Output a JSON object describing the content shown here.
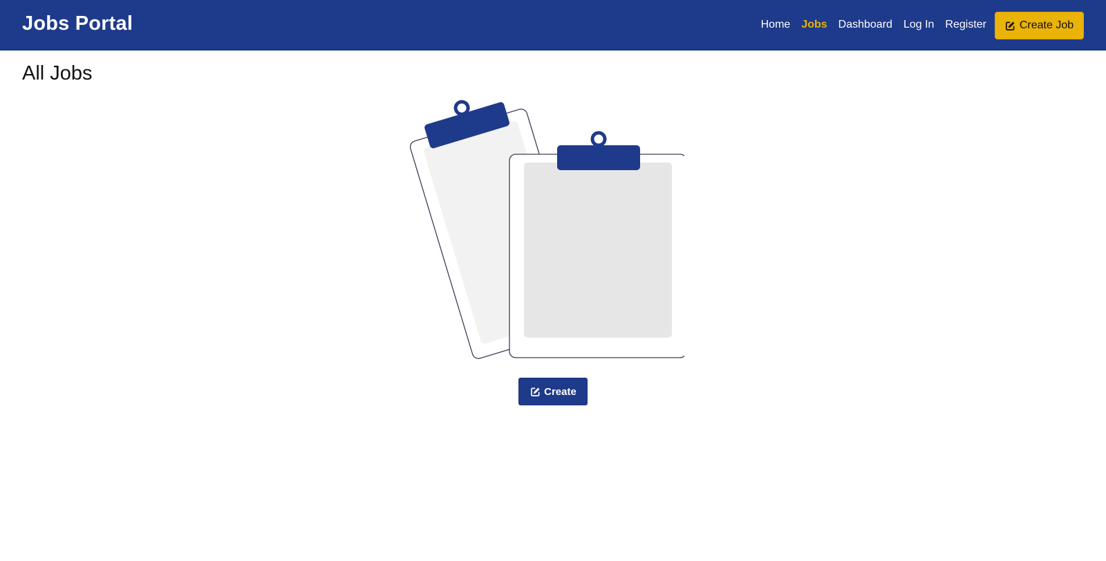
{
  "app": {
    "brand": "Jobs Portal"
  },
  "nav": {
    "items": [
      {
        "label": "Home",
        "active": false
      },
      {
        "label": "Jobs",
        "active": true
      },
      {
        "label": "Dashboard",
        "active": false
      },
      {
        "label": "Log In",
        "active": false
      },
      {
        "label": "Register",
        "active": false
      }
    ],
    "create_job_label": "Create Job",
    "create_job_icon": "edit-icon"
  },
  "main": {
    "title": "All Jobs",
    "empty_state_illustration": "clipboards-illustration",
    "create_label": "Create",
    "create_icon": "edit-icon"
  },
  "colors": {
    "primary": "#1e3a8a",
    "accent": "#eab308",
    "text": "#111111",
    "background": "#ffffff"
  }
}
